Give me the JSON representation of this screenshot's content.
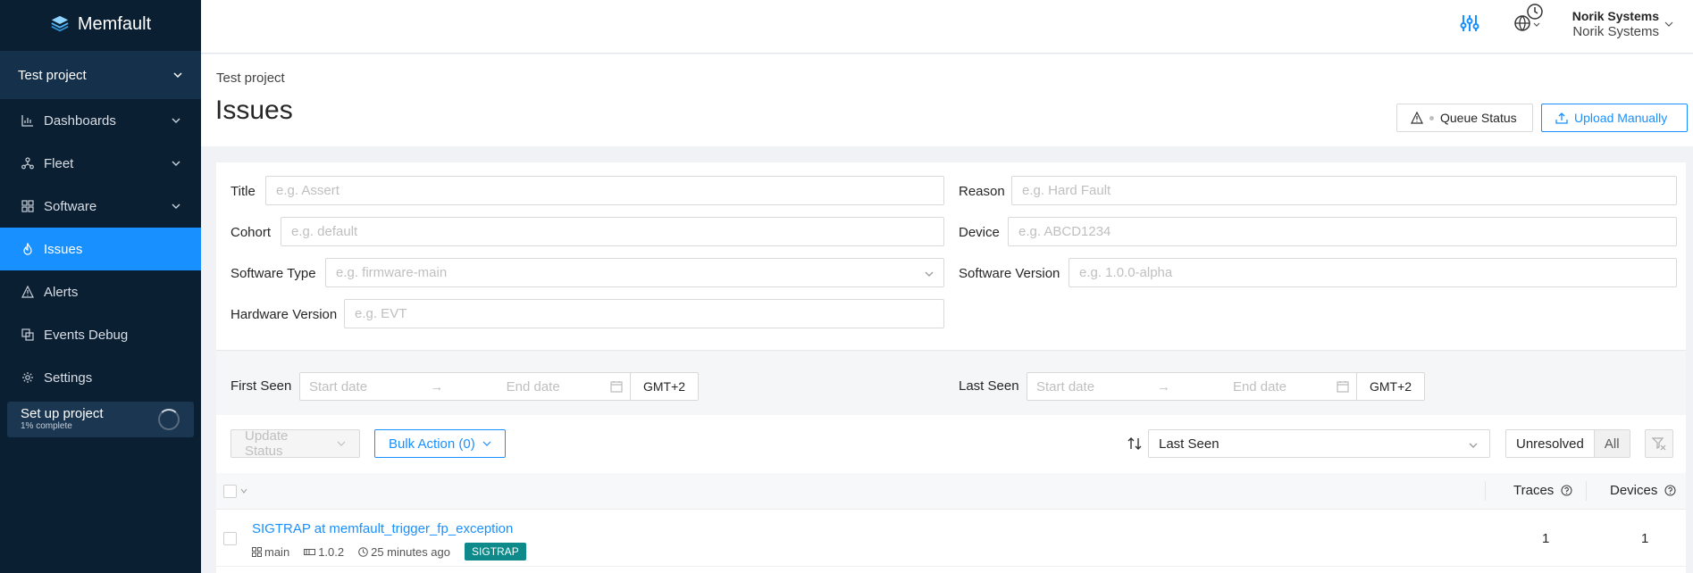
{
  "brand": {
    "name": "Memfault"
  },
  "sidebar": {
    "project": "Test project",
    "items": [
      {
        "label": "Dashboards",
        "icon": "chart-icon",
        "has_chevron": true,
        "active": false
      },
      {
        "label": "Fleet",
        "icon": "fleet-icon",
        "has_chevron": true,
        "active": false
      },
      {
        "label": "Software",
        "icon": "grid-icon",
        "has_chevron": true,
        "active": false
      },
      {
        "label": "Issues",
        "icon": "flame-icon",
        "has_chevron": false,
        "active": true
      },
      {
        "label": "Alerts",
        "icon": "alert-icon",
        "has_chevron": false,
        "active": false
      },
      {
        "label": "Events Debug",
        "icon": "debug-icon",
        "has_chevron": false,
        "active": false
      },
      {
        "label": "Settings",
        "icon": "gear-icon",
        "has_chevron": false,
        "active": false
      }
    ],
    "setup": {
      "title": "Set up project",
      "progress_text": "1% complete",
      "progress": 0.01
    }
  },
  "topbar": {
    "org_name": "Norik Systems",
    "org_sub": "Norik Systems"
  },
  "header": {
    "breadcrumb": "Test project",
    "title": "Issues",
    "queue_status": "Queue Status",
    "upload": "Upload Manually"
  },
  "filters": {
    "title": {
      "label": "Title",
      "placeholder": "e.g. Assert"
    },
    "reason": {
      "label": "Reason",
      "placeholder": "e.g. Hard Fault"
    },
    "cohort": {
      "label": "Cohort",
      "placeholder": "e.g. default"
    },
    "device": {
      "label": "Device",
      "placeholder": "e.g. ABCD1234"
    },
    "software_type": {
      "label": "Software Type",
      "placeholder": "e.g. firmware-main"
    },
    "software_version": {
      "label": "Software Version",
      "placeholder": "e.g. 1.0.0-alpha"
    },
    "hardware_version": {
      "label": "Hardware Version",
      "placeholder": "e.g. EVT"
    }
  },
  "dates": {
    "first_seen": {
      "label": "First Seen",
      "start": "Start date",
      "end": "End date",
      "tz": "GMT+2"
    },
    "last_seen": {
      "label": "Last Seen",
      "start": "Start date",
      "end": "End date",
      "tz": "GMT+2"
    }
  },
  "actions": {
    "update_status": "Update Status",
    "bulk_action": "Bulk Action (0)",
    "sort_value": "Last Seen",
    "seg_unresolved": "Unresolved",
    "seg_all": "All"
  },
  "table": {
    "columns": {
      "traces": "Traces",
      "devices": "Devices"
    },
    "rows": [
      {
        "title": "SIGTRAP at memfault_trigger_fp_exception",
        "software_type": "main",
        "version": "1.0.2",
        "time": "25 minutes ago",
        "tag": "SIGTRAP",
        "traces": "1",
        "devices": "1"
      }
    ]
  },
  "colors": {
    "accent": "#1890ff",
    "sidebar": "#0b1f33",
    "tag": "#0e8a8a"
  }
}
